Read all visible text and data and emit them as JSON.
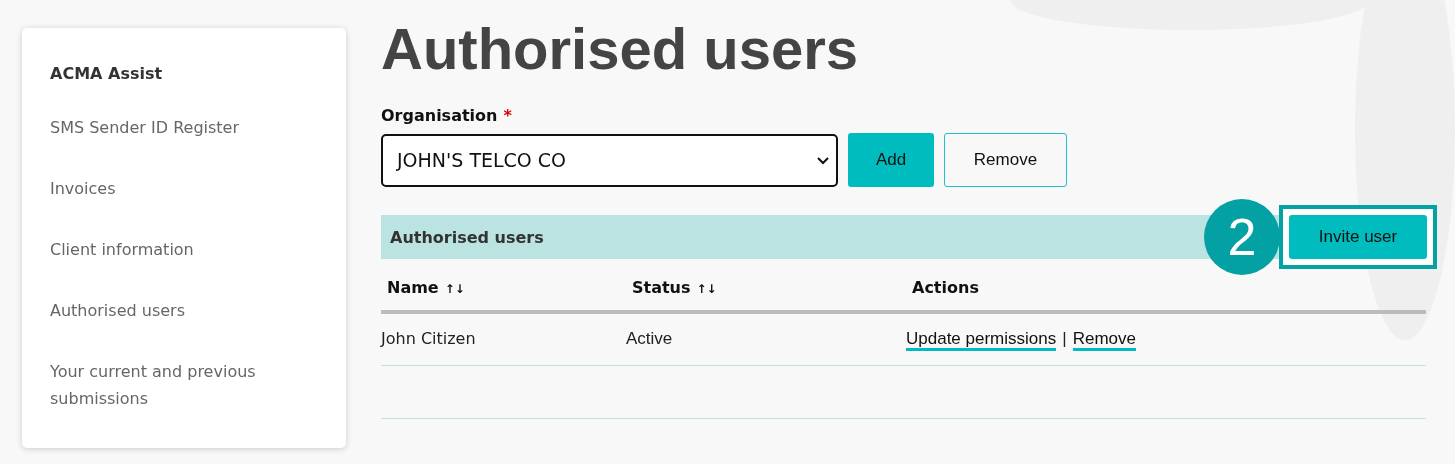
{
  "sidebar": {
    "title": "ACMA Assist",
    "items": [
      {
        "label": "SMS Sender ID Register"
      },
      {
        "label": "Invoices"
      },
      {
        "label": "Client information"
      },
      {
        "label": "Authorised users"
      },
      {
        "label": "Your current and previous submissions"
      }
    ]
  },
  "page_title": "Authorised users",
  "organisation": {
    "label": "Organisation",
    "required_mark": "*",
    "value": "JOHN'S TELCO CO"
  },
  "buttons": [
    {
      "label": "Add",
      "kind": "primary"
    },
    {
      "label": "Remove",
      "kind": "secondary"
    }
  ],
  "panel": {
    "title": "Authorised users",
    "callout": "2",
    "invite_button": "Invite user"
  },
  "table": {
    "columns": [
      {
        "label": "Name",
        "sort_icon": "↑↓"
      },
      {
        "label": "Status",
        "sort_icon": "↑↓"
      },
      {
        "label": "Actions"
      }
    ],
    "rows": [
      {
        "cells": [
          "John Citizen",
          "Active"
        ],
        "actions": [
          "Update permissions",
          "Remove"
        ],
        "separator": "|"
      }
    ]
  }
}
